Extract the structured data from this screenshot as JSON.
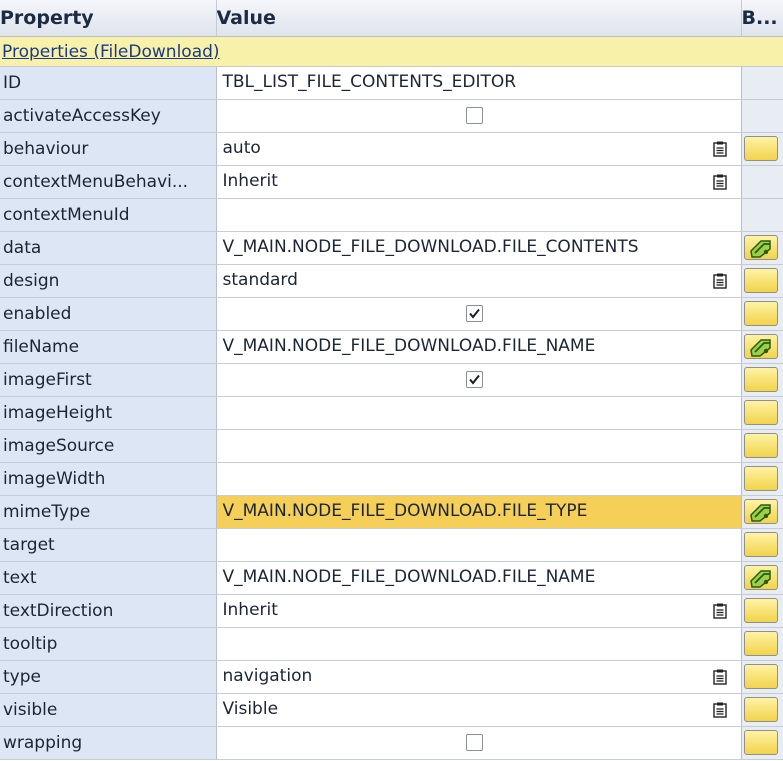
{
  "header": {
    "property": "Property",
    "value": "Value",
    "binding": "B..."
  },
  "group": {
    "label": "Properties (FileDownload)"
  },
  "rows": [
    {
      "name": "ID",
      "value": "TBL_LIST_FILE_CONTENTS_EDITOR",
      "kind": "text",
      "picker": false,
      "button": "none",
      "highlight": false
    },
    {
      "name": "activateAccessKey",
      "value": "",
      "kind": "checkbox",
      "checked": false,
      "picker": false,
      "button": "none",
      "highlight": false
    },
    {
      "name": "behaviour",
      "value": "auto",
      "kind": "text",
      "picker": true,
      "button": "plain",
      "highlight": false
    },
    {
      "name": "contextMenuBehavi...",
      "value": "Inherit",
      "kind": "text",
      "picker": true,
      "button": "none",
      "highlight": false
    },
    {
      "name": "contextMenuId",
      "value": "",
      "kind": "text",
      "picker": false,
      "button": "none",
      "highlight": false
    },
    {
      "name": "data",
      "value": "V_MAIN.NODE_FILE_DOWNLOAD.FILE_CONTENTS",
      "kind": "text",
      "picker": false,
      "button": "bound",
      "highlight": false
    },
    {
      "name": "design",
      "value": "standard",
      "kind": "text",
      "picker": true,
      "button": "plain",
      "highlight": false
    },
    {
      "name": "enabled",
      "value": "",
      "kind": "checkbox",
      "checked": true,
      "picker": false,
      "button": "plain",
      "highlight": false
    },
    {
      "name": "fileName",
      "value": "V_MAIN.NODE_FILE_DOWNLOAD.FILE_NAME",
      "kind": "text",
      "picker": false,
      "button": "bound",
      "highlight": false
    },
    {
      "name": "imageFirst",
      "value": "",
      "kind": "checkbox",
      "checked": true,
      "picker": false,
      "button": "plain",
      "highlight": false
    },
    {
      "name": "imageHeight",
      "value": "",
      "kind": "text",
      "picker": false,
      "button": "plain",
      "highlight": false
    },
    {
      "name": "imageSource",
      "value": "",
      "kind": "text",
      "picker": false,
      "button": "plain",
      "highlight": false
    },
    {
      "name": "imageWidth",
      "value": "",
      "kind": "text",
      "picker": false,
      "button": "plain",
      "highlight": false
    },
    {
      "name": "mimeType",
      "value": "V_MAIN.NODE_FILE_DOWNLOAD.FILE_TYPE",
      "kind": "text",
      "picker": false,
      "button": "bound",
      "highlight": true
    },
    {
      "name": "target",
      "value": "",
      "kind": "text",
      "picker": false,
      "button": "plain",
      "highlight": false
    },
    {
      "name": "text",
      "value": "V_MAIN.NODE_FILE_DOWNLOAD.FILE_NAME",
      "kind": "text",
      "picker": false,
      "button": "bound",
      "highlight": false
    },
    {
      "name": "textDirection",
      "value": "Inherit",
      "kind": "text",
      "picker": true,
      "button": "plain",
      "highlight": false
    },
    {
      "name": "tooltip",
      "value": "",
      "kind": "text",
      "picker": false,
      "button": "plain",
      "highlight": false
    },
    {
      "name": "type",
      "value": "navigation",
      "kind": "text",
      "picker": true,
      "button": "plain",
      "highlight": false
    },
    {
      "name": "visible",
      "value": "Visible",
      "kind": "text",
      "picker": true,
      "button": "plain",
      "highlight": false
    },
    {
      "name": "wrapping",
      "value": "",
      "kind": "checkbox",
      "checked": false,
      "picker": false,
      "button": "plain",
      "highlight": false
    }
  ],
  "icons": {
    "picker": "value-help-icon",
    "bound": "data-binding-icon",
    "checkmark": "checkmark-icon"
  },
  "colors": {
    "highlight": "#f6cf59",
    "group_bg": "#f7f1a9",
    "property_bg": "#dce6f4",
    "button_yellow": "#f6dc5c"
  }
}
